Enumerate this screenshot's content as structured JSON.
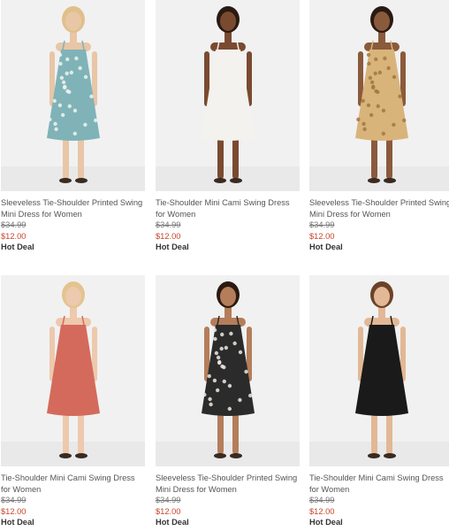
{
  "products": [
    {
      "title": "Sleeveless Tie-Shoulder Printed Swing Mini Dress for Women",
      "was": "$34.99",
      "now": "$12.00",
      "deal": "Hot Deal",
      "dress_color": "#7fb3b8",
      "skin": "#e8c6a6",
      "hair": "#e0c08a",
      "pattern": "floral-teal"
    },
    {
      "title": "Tie-Shoulder Mini Cami Swing Dress for Women",
      "was": "$34.99",
      "now": "$12.00",
      "deal": "Hot Deal",
      "dress_color": "#f4f2ee",
      "skin": "#7a4a30",
      "hair": "#2a1a12",
      "pattern": "solid"
    },
    {
      "title": "Sleeveless Tie-Shoulder Printed Swing Mini Dress for Women",
      "was": "$34.99",
      "now": "$12.00",
      "deal": "Hot Deal",
      "dress_color": "#d9b47a",
      "skin": "#8a5a3c",
      "hair": "#2a1a12",
      "pattern": "floral-tan"
    },
    {
      "title": "Tie-Shoulder Mini Cami Swing Dress for Women",
      "was": "$34.99",
      "now": "$12.00",
      "deal": "Hot Deal",
      "dress_color": "#d46a5c",
      "skin": "#edc9ad",
      "hair": "#e3c48f",
      "pattern": "solid"
    },
    {
      "title": "Sleeveless Tie-Shoulder Printed Swing Mini Dress for Women",
      "was": "$34.99",
      "now": "$12.00",
      "deal": "Hot Deal",
      "dress_color": "#2b2b2b",
      "skin": "#b47e5a",
      "hair": "#2a1a12",
      "pattern": "floral-dark"
    },
    {
      "title": "Tie-Shoulder Mini Cami Swing Dress for Women",
      "was": "$34.99",
      "now": "$12.00",
      "deal": "Hot Deal",
      "dress_color": "#1a1a1a",
      "skin": "#e2b896",
      "hair": "#6b4228",
      "pattern": "solid"
    }
  ]
}
